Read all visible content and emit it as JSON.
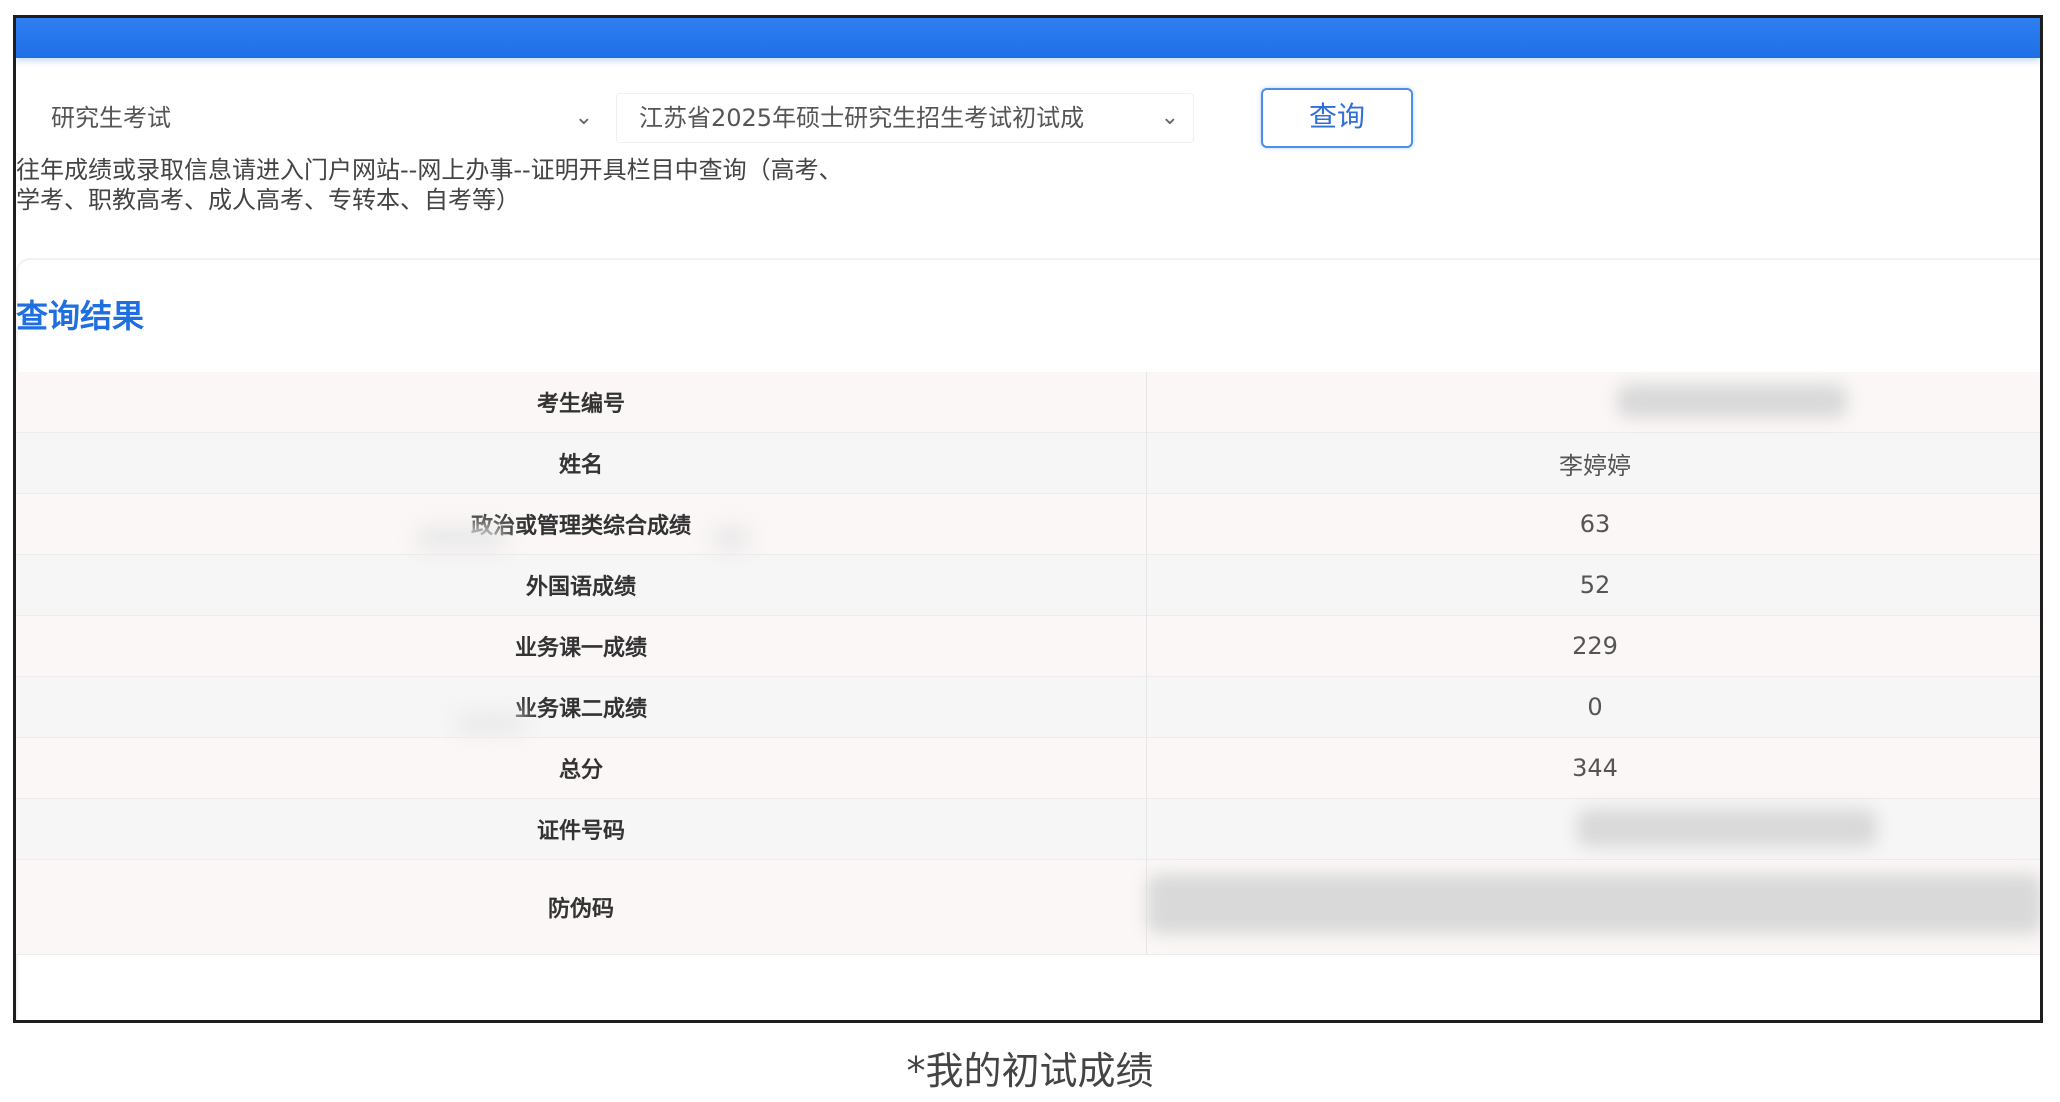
{
  "header": {
    "title": ""
  },
  "filters": {
    "exam_type": {
      "value": "研究生考试"
    },
    "exam_name": {
      "value": "江苏省2025年硕士研究生招生考试初试成"
    },
    "query_button": "查询"
  },
  "notice": {
    "line1": "往年成绩或录取信息请进入门户网站--网上办事--证明开具栏目中查询（高考、",
    "line2": "学考、职教高考、成人高考、专转本、自考等）"
  },
  "results": {
    "title": "查询结果",
    "rows": [
      {
        "label": "考生编号",
        "value": ""
      },
      {
        "label": "姓名",
        "value": "李婷婷"
      },
      {
        "label": "政治或管理类综合成绩",
        "value": "63"
      },
      {
        "label": "外国语成绩",
        "value": "52"
      },
      {
        "label": "业务课一成绩",
        "value": "229"
      },
      {
        "label": "业务课二成绩",
        "value": "0"
      },
      {
        "label": "总分",
        "value": "344"
      },
      {
        "label": "证件号码",
        "value": ""
      },
      {
        "label": "防伪码",
        "value": ""
      }
    ]
  },
  "caption": "*我的初试成绩",
  "colors": {
    "primary": "#1e6fe6",
    "title_blue": "#1f6fe0",
    "button_border": "#4b8fe8"
  },
  "icons": {
    "select_arrow": "chevron-down-icon"
  }
}
